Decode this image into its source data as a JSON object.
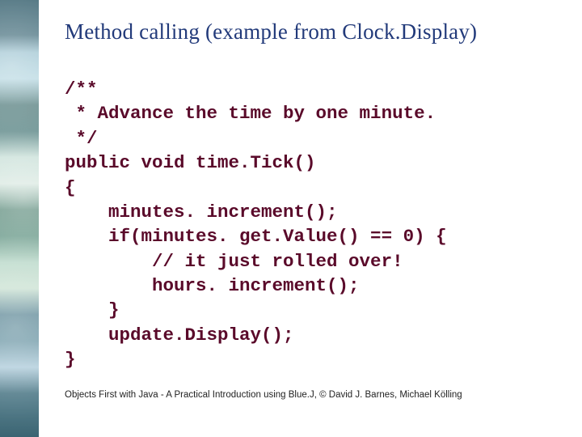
{
  "slide": {
    "title": "Method calling (example from Clock.Display)",
    "code": "/**\n * Advance the time by one minute.\n */\npublic void time.Tick()\n{\n    minutes. increment();\n    if(minutes. get.Value() == 0) {\n        // it just rolled over!\n        hours. increment();\n    }\n    update.Display();\n}",
    "footer": "Objects First with Java - A Practical Introduction using Blue.J, © David J. Barnes, Michael Kölling"
  }
}
